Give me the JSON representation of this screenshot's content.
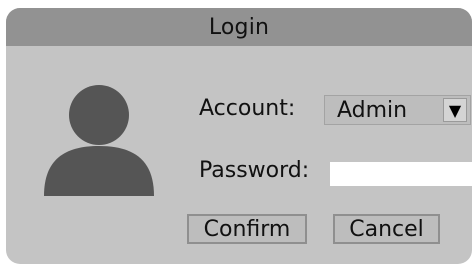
{
  "dialog": {
    "title": "Login"
  },
  "avatar": {
    "icon": "user-avatar-icon",
    "color": "#555555"
  },
  "form": {
    "account_label": "Account:",
    "account_value": "Admin",
    "account_arrow": "▼",
    "password_label": "Password:",
    "password_value": ""
  },
  "buttons": {
    "confirm_label": "Confirm",
    "cancel_label": "Cancel"
  },
  "colors": {
    "dialog_bg": "#c4c4c4",
    "titlebar_bg": "#929292",
    "icon": "#555555"
  }
}
